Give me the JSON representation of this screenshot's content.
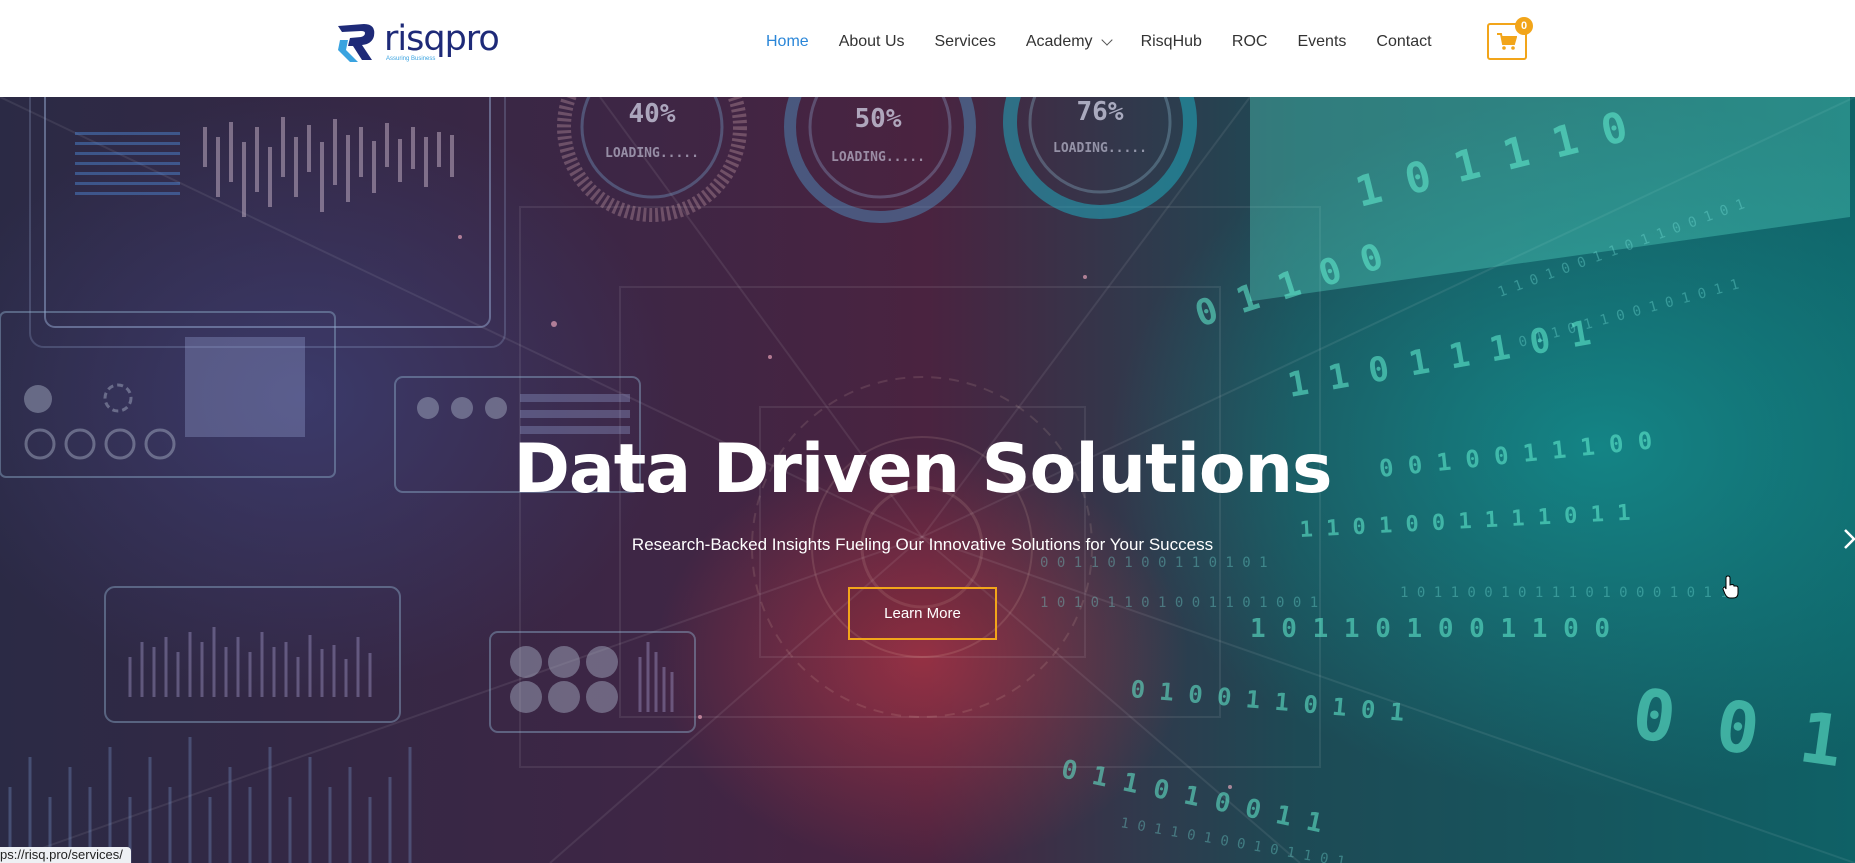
{
  "header": {
    "logo_text": "risqpro",
    "logo_tagline": "Assuring Business",
    "nav": [
      {
        "label": "Home",
        "active": true
      },
      {
        "label": "About Us"
      },
      {
        "label": "Services"
      },
      {
        "label": "Academy",
        "dropdown": true
      },
      {
        "label": "RisqHub"
      },
      {
        "label": "ROC"
      },
      {
        "label": "Events"
      },
      {
        "label": "Contact"
      }
    ],
    "cart_count": "0",
    "cart_icon": "shopping-cart-icon"
  },
  "hero": {
    "title": "Data Driven Solutions",
    "subtitle": "Research-Backed Insights Fueling Our Innovative Solutions for Your Success",
    "button_label": "Learn More",
    "background_gauges": [
      {
        "percent": "40%",
        "label": "LOADING....."
      },
      {
        "percent": "50%",
        "label": "LOADING....."
      },
      {
        "percent": "76%",
        "label": "LOADING....."
      }
    ],
    "next_icon": "chevron-right-icon"
  },
  "status_bar": {
    "url": "ps://risq.pro/services/"
  },
  "colors": {
    "accent": "#f2a51a",
    "nav_active": "#2a86d8",
    "logo_blue": "#1e2a78"
  }
}
